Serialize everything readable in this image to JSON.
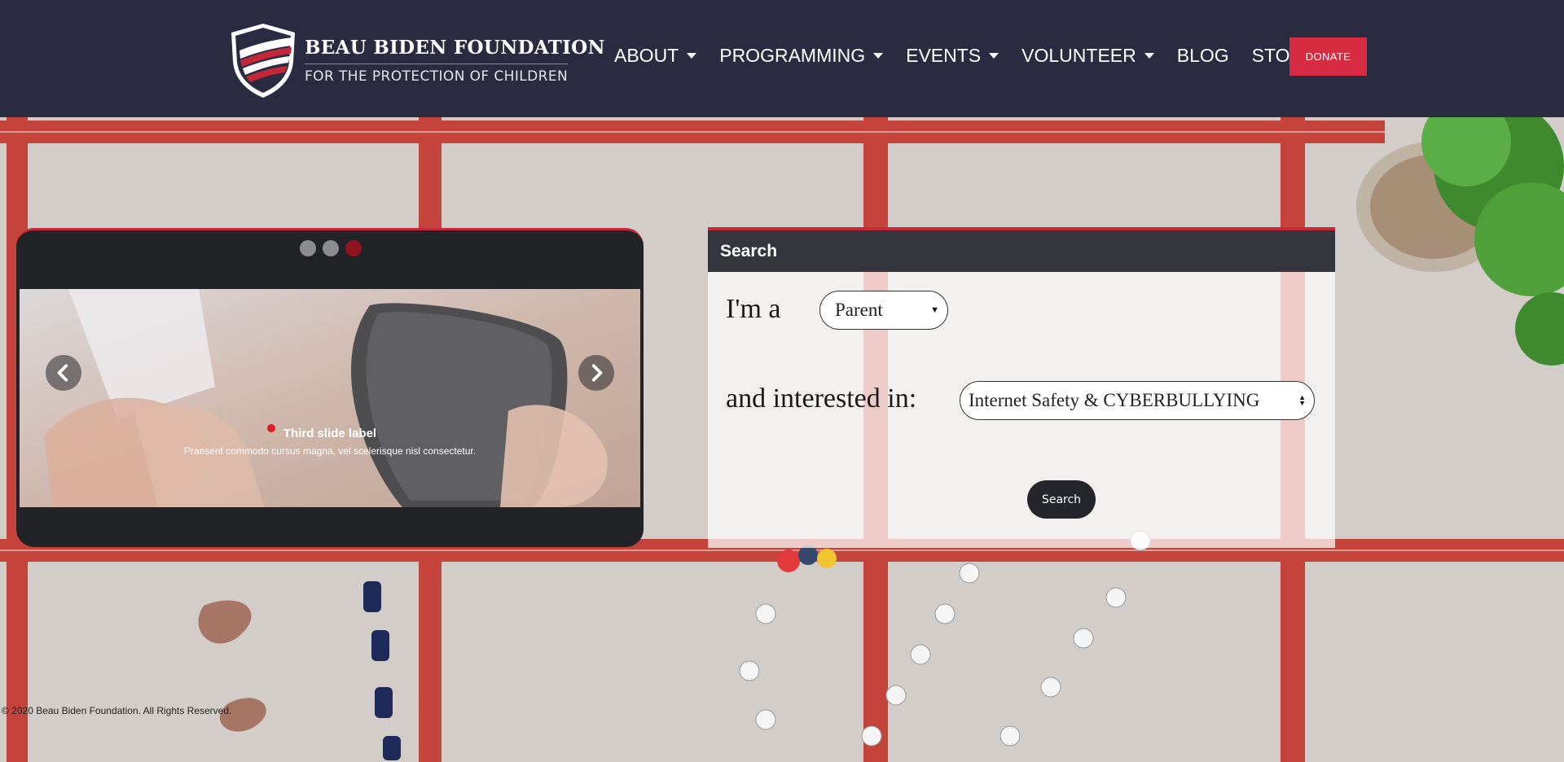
{
  "brand": {
    "title": "BEAU BIDEN FOUNDATION",
    "subtitle": "FOR THE PROTECTION OF CHILDREN"
  },
  "nav": {
    "items": [
      {
        "label": "ABOUT",
        "dropdown": true
      },
      {
        "label": "PROGRAMMING",
        "dropdown": true
      },
      {
        "label": "EVENTS",
        "dropdown": true
      },
      {
        "label": "VOLUNTEER",
        "dropdown": true
      },
      {
        "label": "BLOG",
        "dropdown": false
      },
      {
        "label": "STORE",
        "dropdown": false
      }
    ],
    "donate_label": "DONATE"
  },
  "carousel": {
    "active_index": 2,
    "slide_count": 3,
    "caption_title": "Third slide label",
    "caption_text": "Praesent commodo cursus magna, vel scelerisque nisl consectetur."
  },
  "search": {
    "heading": "Search",
    "role_label": "I'm a",
    "role_value": "Parent",
    "interest_label": "and interested in:",
    "interest_value": "Internet Safety & CYBERBULLYING",
    "button_label": "Search"
  },
  "footer": {
    "copyright": "© 2020 Beau Biden Foundation. All Rights Reserved."
  },
  "colors": {
    "header_bg": "#2a2b40",
    "accent_red": "#d62b40",
    "panel_dark": "#222327"
  },
  "icons": [
    "shield-logo-icon",
    "caret-down-icon",
    "chevron-left-icon",
    "chevron-right-icon",
    "select-arrow-icon"
  ]
}
